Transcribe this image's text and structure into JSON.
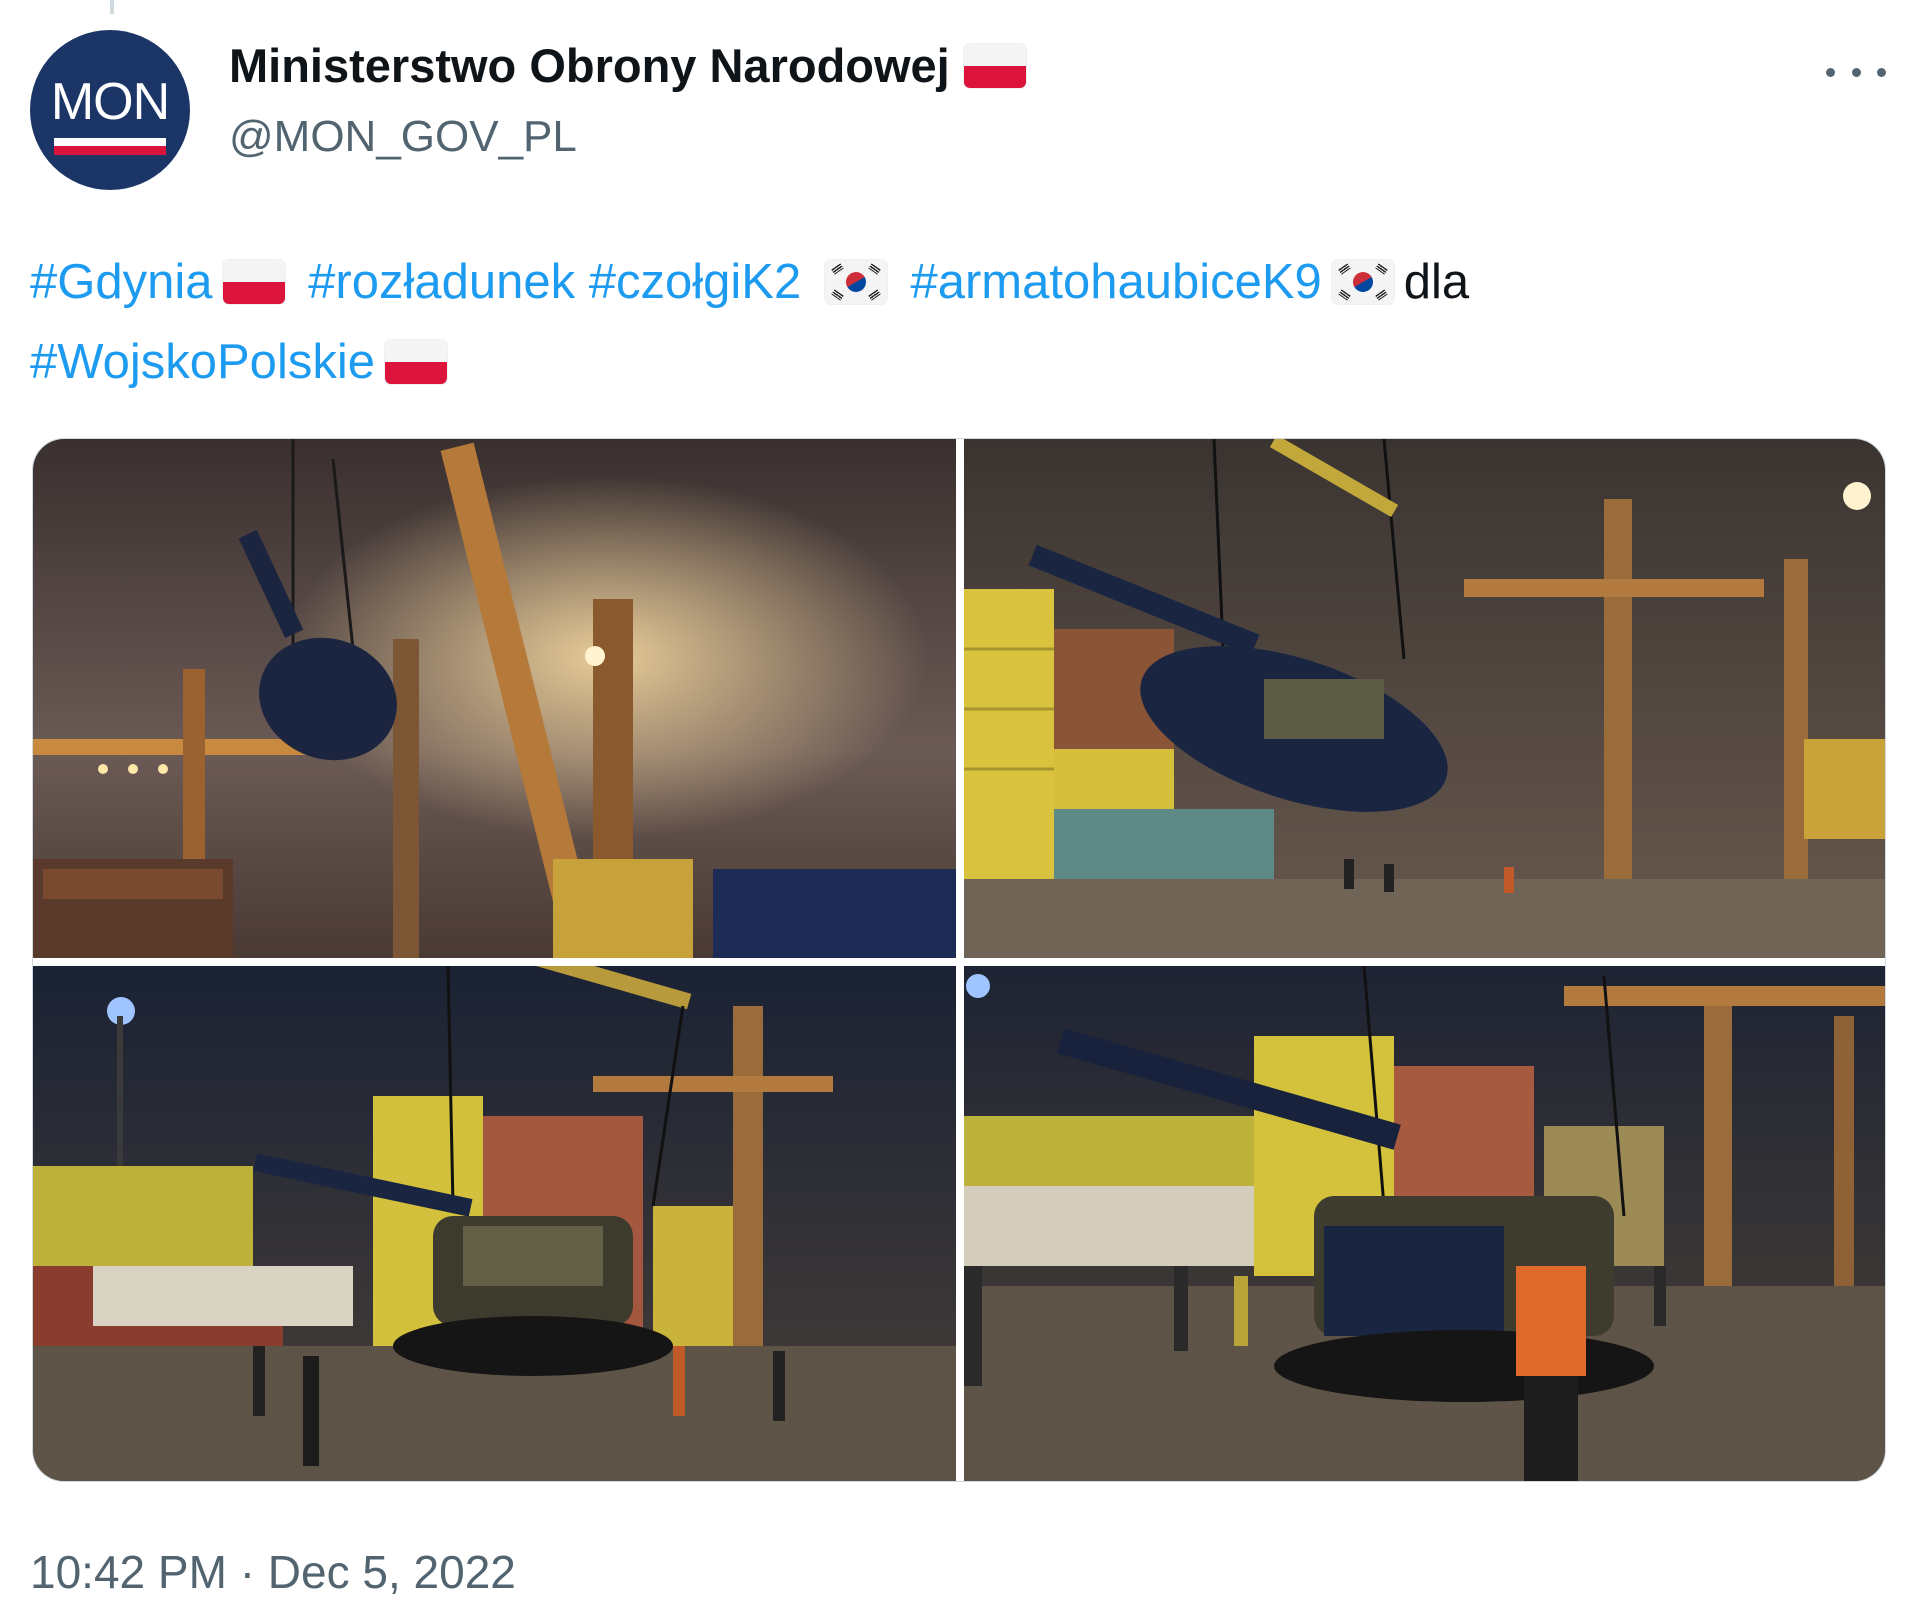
{
  "author": {
    "display_name": "Ministerstwo Obrony Narodowej",
    "handle": "@MON_GOV_PL",
    "avatar_text": "MON",
    "name_flag": "poland-flag-icon"
  },
  "tweet": {
    "segments": [
      {
        "type": "hashtag",
        "text": "#Gdynia"
      },
      {
        "type": "flag",
        "icon": "poland-flag-icon"
      },
      {
        "type": "hashtag",
        "text": "#rozładunek"
      },
      {
        "type": "hashtag",
        "text": "#czołgiK2"
      },
      {
        "type": "flag",
        "icon": "south-korea-flag-icon"
      },
      {
        "type": "hashtag",
        "text": "#armatohaubiceK9"
      },
      {
        "type": "flag",
        "icon": "south-korea-flag-icon"
      },
      {
        "type": "text",
        "text": "dla"
      },
      {
        "type": "hashtag",
        "text": "#WojskoPolskie"
      },
      {
        "type": "flag",
        "icon": "poland-flag-icon"
      }
    ],
    "hashtags": {
      "gdynia": "#Gdynia",
      "rozladunek": "#rozładunek",
      "czolgi": "#czołgiK2",
      "armatohaubice": "#armatohaubiceK9",
      "dla": "dla",
      "wojsko": "#WojskoPolskie"
    }
  },
  "media": {
    "count": 4,
    "photos": [
      "photo-1",
      "photo-2",
      "photo-3",
      "photo-4"
    ]
  },
  "meta": {
    "time": "10:42 PM",
    "separator": "·",
    "date": "Dec 5, 2022"
  },
  "colors": {
    "link": "#1d9bf0",
    "secondary_text": "#536471",
    "primary_text": "#0f1419",
    "avatar_bg": "#1b3566"
  }
}
